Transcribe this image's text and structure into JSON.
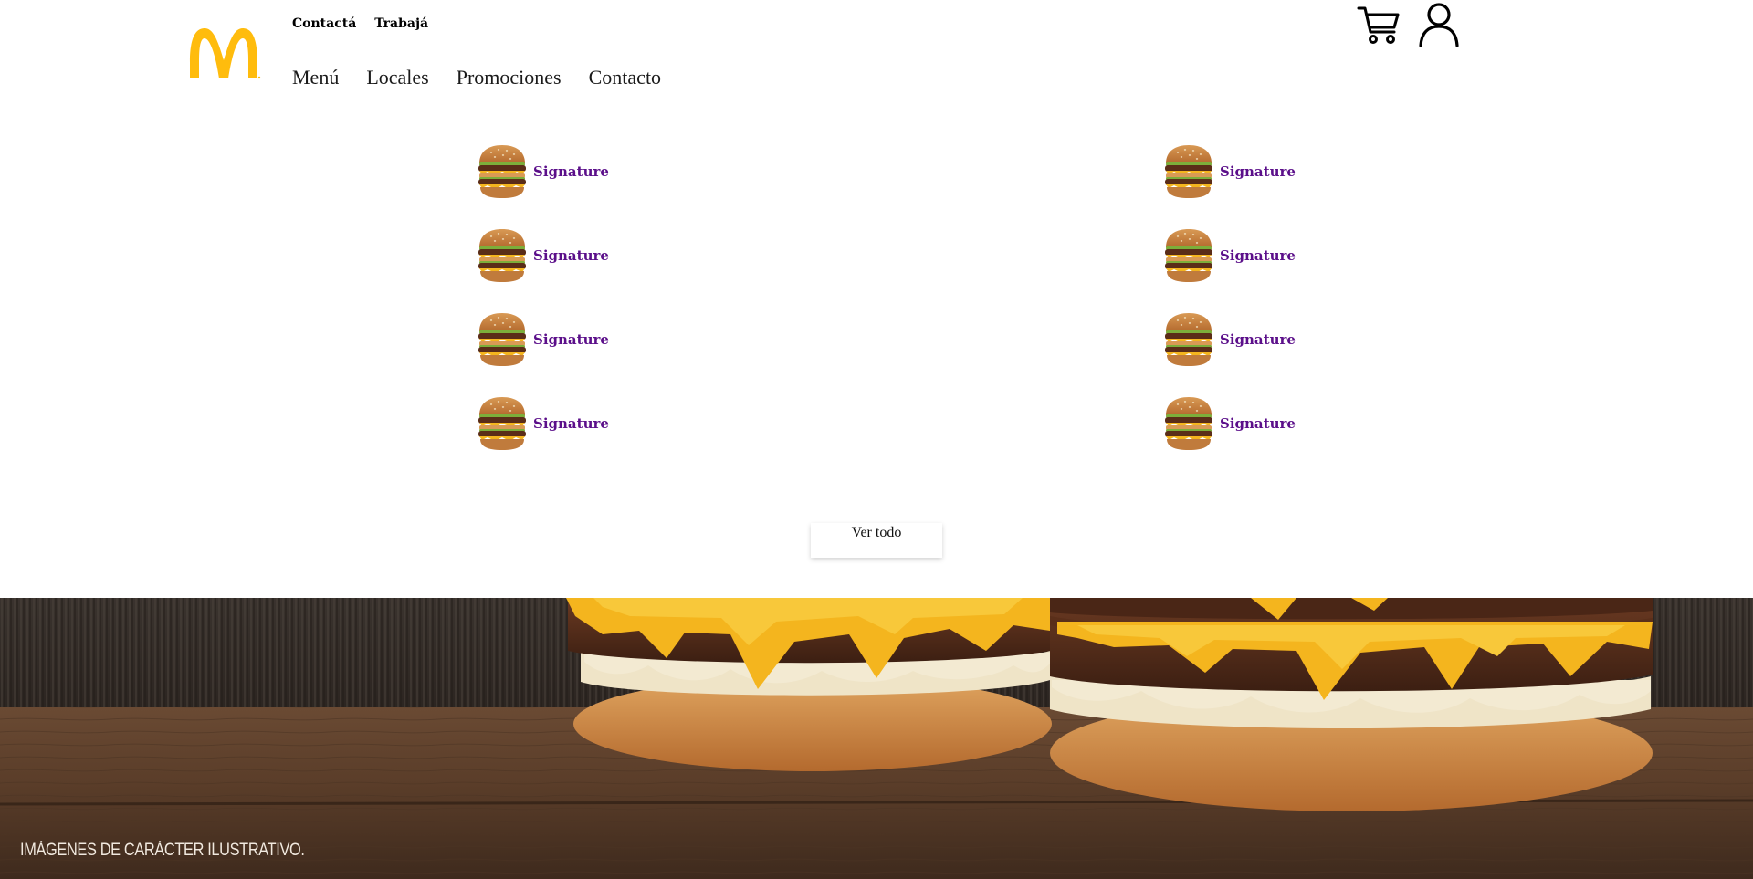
{
  "header": {
    "logo": {
      "icon": "golden-arches-icon",
      "color": "#FFBC0D"
    },
    "utility_links": [
      "Contactá",
      "Trabajá"
    ],
    "nav": [
      "Menú",
      "Locales",
      "Promociones",
      "Contacto"
    ],
    "icons": {
      "cart": "cart-icon",
      "user": "user-icon"
    }
  },
  "products": {
    "left": [
      {
        "label": "Signature",
        "icon": "burger-thumbnail"
      },
      {
        "label": "Signature",
        "icon": "burger-thumbnail"
      },
      {
        "label": "Signature",
        "icon": "burger-thumbnail"
      },
      {
        "label": "Signature",
        "icon": "burger-thumbnail"
      }
    ],
    "right": [
      {
        "label": "Signature",
        "icon": "burger-thumbnail"
      },
      {
        "label": "Signature",
        "icon": "burger-thumbnail"
      },
      {
        "label": "Signature",
        "icon": "burger-thumbnail"
      },
      {
        "label": "Signature",
        "icon": "burger-thumbnail"
      }
    ],
    "label_color": "#5B0F8A"
  },
  "ver_todo": "Ver todo",
  "hero": {
    "caption": "IMÁGENES DE CARÁCTER ILUSTRATIVO."
  }
}
